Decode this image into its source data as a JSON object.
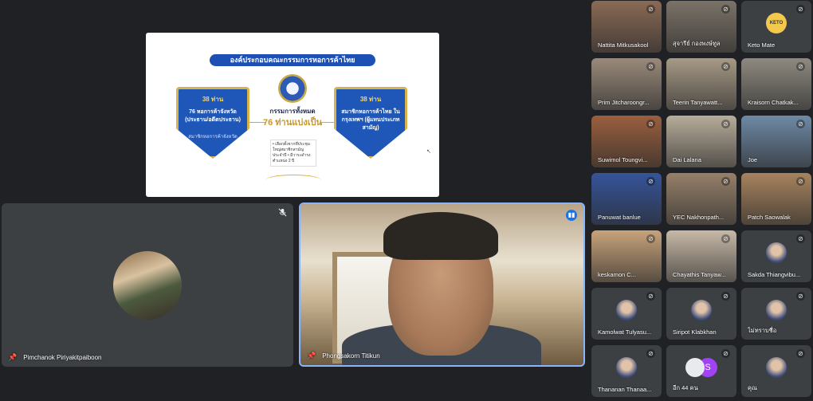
{
  "slide": {
    "header": "องค์ประกอบคณะกรรมการหอการค้าไทย",
    "left_shield": {
      "count": "38 ท่าน",
      "main": "76 หอการค้าจังหวัด (ประธาน/อดีตประธาน)",
      "sub": "สมาชิกหอการค้าจังหวัด"
    },
    "center": {
      "title": "กรรมการทั้งหมด",
      "big": "76 ท่านแบ่งเป็น",
      "note": "• เลือกตั้งจากที่ประชุมใหญ่สมาชิกสามัญประจำปี • มีวาระดำรงตำแหน่ง 2 ปี"
    },
    "right_shield": {
      "count": "38 ท่าน",
      "main": "สมาชิกหอการค้าไทย ในกรุงเทพฯ (ผู้แทนประเภทสามัญ)"
    }
  },
  "main_tiles": [
    {
      "name": "Pimchanok Piriyakitpaiboon"
    },
    {
      "name": "Phongsakorn Titikun"
    }
  ],
  "participants": [
    {
      "name": "Nattita Mitkusakool",
      "color": "#8a6a55"
    },
    {
      "name": "สุจารีย์ กองพงษ์ทูล",
      "color": "#7b7368"
    },
    {
      "name": "Keto Mate",
      "color": "#3c4043",
      "avatar_text": "KETO"
    },
    {
      "name": "Prim Jitcharoongr...",
      "color": "#9a8a7a"
    },
    {
      "name": "Teerin Tanyawatt...",
      "color": "#a79a86"
    },
    {
      "name": "Kraisorn Chatkak...",
      "color": "#8f8a80"
    },
    {
      "name": "Suwimol Toungvi...",
      "color": "#9a5f3e"
    },
    {
      "name": "Dai Lalana",
      "color": "#b8ad9b"
    },
    {
      "name": "Joe",
      "color": "#6e8aa6"
    },
    {
      "name": "Panuwat banlue",
      "color": "#36549a"
    },
    {
      "name": "YEC Nakhonpath...",
      "color": "#96806a"
    },
    {
      "name": "Patch Saowalak",
      "color": "#a7835e"
    },
    {
      "name": "keskamon C...",
      "color": "#c8a37b"
    },
    {
      "name": "Chayathis Tanyaw...",
      "color": "#c7b9a7"
    },
    {
      "name": "Sakda Thiangvibu...",
      "color": "#3c4043"
    },
    {
      "name": "Kamolwat Tulyasu...",
      "color": "#3c4043"
    },
    {
      "name": "Siripot Klabkhan",
      "color": "#3c4043"
    },
    {
      "name": "ไม่ทราบชื่อ",
      "color": "#3c4043"
    },
    {
      "name": "Thananan Thanaa...",
      "color": "#3c4043"
    },
    {
      "name": "อีก 44 คน",
      "color": "#3c4043",
      "avatar_text": "S"
    },
    {
      "name": "คุณ",
      "color": "#3c4043"
    }
  ],
  "icons": {
    "mute": "mic-off-icon",
    "pin": "pin-icon",
    "speaking": "speaking-indicator-icon"
  },
  "accent_color": "#8ab4f8"
}
